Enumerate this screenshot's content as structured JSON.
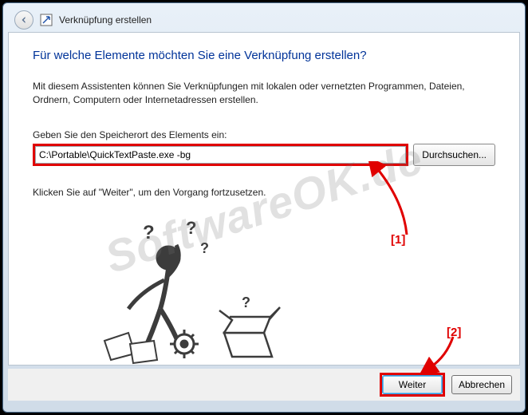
{
  "header": {
    "title": "Verknüpfung erstellen"
  },
  "main": {
    "heading": "Für welche Elemente möchten Sie eine Verknüpfung erstellen?",
    "description": "Mit diesem Assistenten können Sie Verknüpfungen mit lokalen oder vernetzten Programmen, Dateien, Ordnern, Computern oder Internetadressen erstellen.",
    "field_label": "Geben Sie den Speicherort des Elements ein:",
    "path_value": "C:\\Portable\\QuickTextPaste.exe -bg",
    "browse_label": "Durchsuchen...",
    "continue_text": "Klicken Sie auf \"Weiter\", um den Vorgang fortzusetzen."
  },
  "footer": {
    "next_label": "Weiter",
    "cancel_label": "Abbrechen"
  },
  "annotation": {
    "marker1": "[1]",
    "marker2": "[2]"
  },
  "watermark": "SoftwareOK.de"
}
